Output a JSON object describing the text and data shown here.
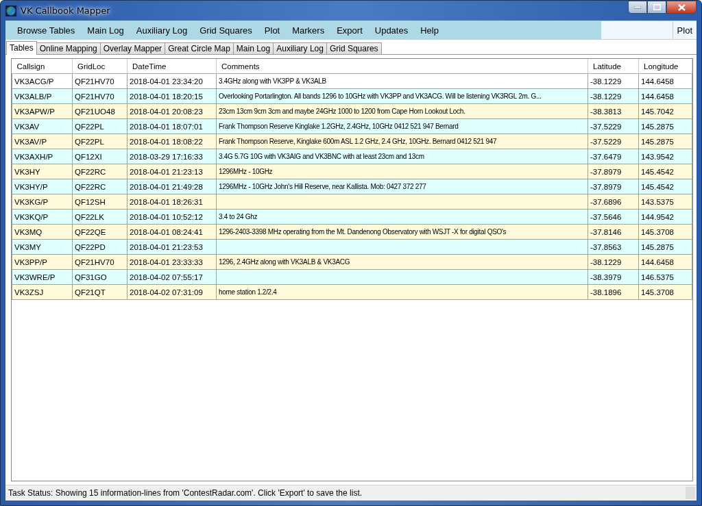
{
  "window": {
    "title": "VK Callbook Mapper"
  },
  "menu": [
    "Browse Tables",
    "Main Log",
    "Auxiliary Log",
    "Grid Squares",
    "Plot",
    "Markers",
    "Export",
    "Updates",
    "Help"
  ],
  "plot_button": "Plot",
  "tabs": [
    {
      "label": "Tables",
      "selected": true
    },
    {
      "label": "Online Mapping",
      "selected": false
    },
    {
      "label": "Overlay Mapper",
      "selected": false
    },
    {
      "label": "Great Circle Map",
      "selected": false
    },
    {
      "label": "Main Log",
      "selected": false
    },
    {
      "label": "Auxiliary Log",
      "selected": false
    },
    {
      "label": "Grid Squares",
      "selected": false
    }
  ],
  "table": {
    "columns": [
      "Callsign",
      "GridLoc",
      "DateTime",
      "Comments",
      "Latitude",
      "Longitude"
    ],
    "rows": [
      {
        "selected": true,
        "cells": [
          "VK3ACG/P",
          "QF21HV70",
          "2018-04-01 23:34:20",
          "3.4GHz along with VK3PP & VK3ALB",
          "-38.1229",
          "144.6458"
        ]
      },
      {
        "selected": false,
        "cells": [
          "VK3ALB/P",
          "QF21HV70",
          "2018-04-01 18:20:15",
          "Overlooking Portarlington. All bands 1296 to 10GHz with VK3PP and VK3ACG. Will be listening VK3RGL 2m. G...",
          "-38.1229",
          "144.6458"
        ]
      },
      {
        "selected": false,
        "cells": [
          "VK3APW/P",
          "QF21UO48",
          "2018-04-01 20:08:23",
          "23cm 13cm 9cm 3cm  and maybe 24GHz 1000 to 1200 from Cape Horn Lookout Loch.",
          "-38.3813",
          "145.7042"
        ]
      },
      {
        "selected": false,
        "cells": [
          "VK3AV",
          "QF22PL",
          "2018-04-01 18:07:01",
          "Frank Thompson Reserve Kinglake 1.2GHz, 2.4GHz, 10GHz  0412 521 947 Bernard",
          "-37.5229",
          "145.2875"
        ]
      },
      {
        "selected": false,
        "cells": [
          "VK3AV/P",
          "QF22PL",
          "2018-04-01 18:08:22",
          "Frank Thompson Reserve, Kinglake  600m ASL 1.2 GHz, 2.4 GHz, 10GHz. Bernard 0412 521 947",
          "-37.5229",
          "145.2875"
        ]
      },
      {
        "selected": false,
        "cells": [
          "VK3AXH/P",
          "QF12XI",
          "2018-03-29 17:16:33",
          "3.4G 5.7G 10G with VK3AIG and VK3BNC with at least 23cm and 13cm",
          "-37.6479",
          "143.9542"
        ]
      },
      {
        "selected": false,
        "cells": [
          "VK3HY",
          "QF22RC",
          "2018-04-01 21:23:13",
          "1296MHz - 10GHz",
          "-37.8979",
          "145.4542"
        ]
      },
      {
        "selected": false,
        "cells": [
          "VK3HY/P",
          "QF22RC",
          "2018-04-01 21:49:28",
          "1296MHz - 10GHz John's Hill Reserve, near Kallista. Mob: 0427 372 277",
          "-37.8979",
          "145.4542"
        ]
      },
      {
        "selected": false,
        "cells": [
          "VK3KG/P",
          "QF12SH",
          "2018-04-01 18:26:31",
          "",
          "-37.6896",
          "143.5375"
        ]
      },
      {
        "selected": false,
        "cells": [
          "VK3KQ/P",
          "QF22LK",
          "2018-04-01 10:52:12",
          "3.4 to 24 Ghz",
          "-37.5646",
          "144.9542"
        ]
      },
      {
        "selected": false,
        "cells": [
          "VK3MQ",
          "QF22QE",
          "2018-04-01 08:24:41",
          "1296-2403-3398 MHz operating from the Mt. Dandenong Observatory with WSJT -X for digital QSO's",
          "-37.8146",
          "145.3708"
        ]
      },
      {
        "selected": false,
        "cells": [
          "VK3MY",
          "QF22PD",
          "2018-04-01 21:23:53",
          "",
          "-37.8563",
          "145.2875"
        ]
      },
      {
        "selected": false,
        "cells": [
          "VK3PP/P",
          "QF21HV70",
          "2018-04-01 23:33:33",
          "1296, 2.4GHz along with VK3ALB & VK3ACG",
          "-38.1229",
          "144.6458"
        ]
      },
      {
        "selected": false,
        "cells": [
          "VK3WRE/P",
          "QF31GO",
          "2018-04-02 07:55:17",
          "",
          "-38.3979",
          "146.5375"
        ]
      },
      {
        "selected": false,
        "cells": [
          "VK3ZSJ",
          "QF21QT",
          "2018-04-02 07:31:09",
          "home station 1.2/2.4",
          "-38.1896",
          "145.3708"
        ]
      }
    ]
  },
  "status_bar": "Task Status: Showing 15 information-lines from 'ContestRadar.com'. Click 'Export' to save the list."
}
